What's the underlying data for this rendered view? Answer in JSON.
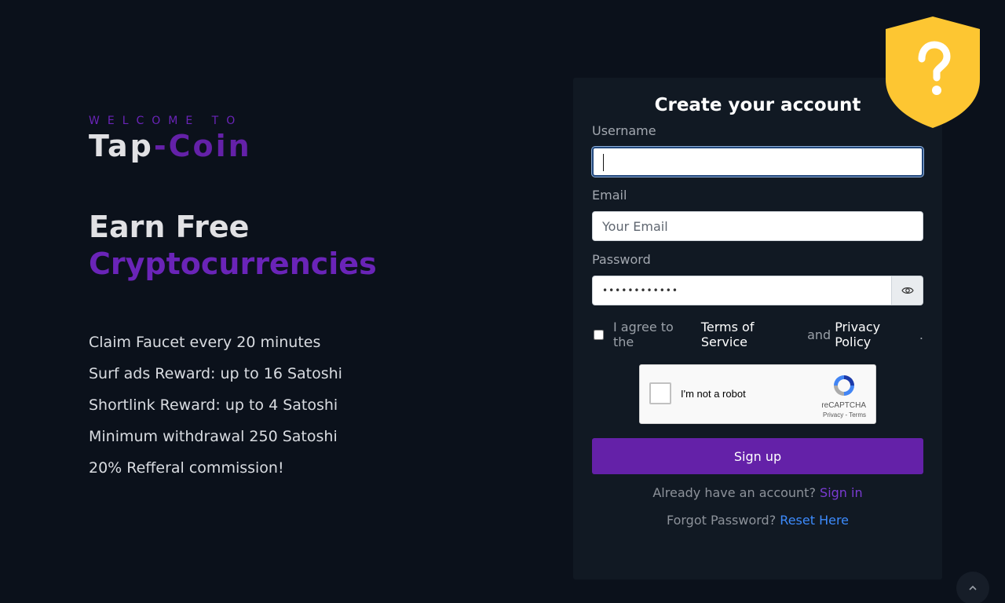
{
  "hero": {
    "welcome": "WELCOME TO",
    "brand_main": "Tap",
    "brand_accent": "-Coin",
    "headline_line1": "Earn Free",
    "headline_line2": "Cryptocurrencies",
    "features": [
      "Claim Faucet every 20 minutes",
      "Surf ads Reward: up to 16 Satoshi",
      "Shortlink Reward: up to 4 Satoshi",
      "Minimum withdrawal 250 Satoshi",
      "20% Refferal commission!"
    ]
  },
  "form": {
    "title": "Create your account",
    "username_label": "Username",
    "username_value": "",
    "email_label": "Email",
    "email_placeholder": "Your Email",
    "password_label": "Password",
    "password_value": "••••••••••••",
    "agree_prefix": "I agree to the",
    "terms_link": "Terms of Service",
    "agree_and": "and",
    "privacy_link": "Privacy Policy",
    "agree_suffix": ".",
    "recaptcha_label": "I'm not a robot",
    "recaptcha_brand": "reCAPTCHA",
    "recaptcha_links": "Privacy - Terms",
    "signup_label": "Sign up",
    "have_account": "Already have an account?",
    "signin_link": "Sign in",
    "forgot": "Forgot Password?",
    "reset_link": "Reset Here"
  },
  "icons": {
    "shield": "shield-question-icon",
    "eye": "eye-icon",
    "scroll_top": "chevron-up-icon"
  },
  "colors": {
    "background": "#0b111b",
    "card": "#111923",
    "accent_purple": "#6421a8",
    "link_blue": "#3d8bfd",
    "shield_yellow": "#fdc632"
  }
}
